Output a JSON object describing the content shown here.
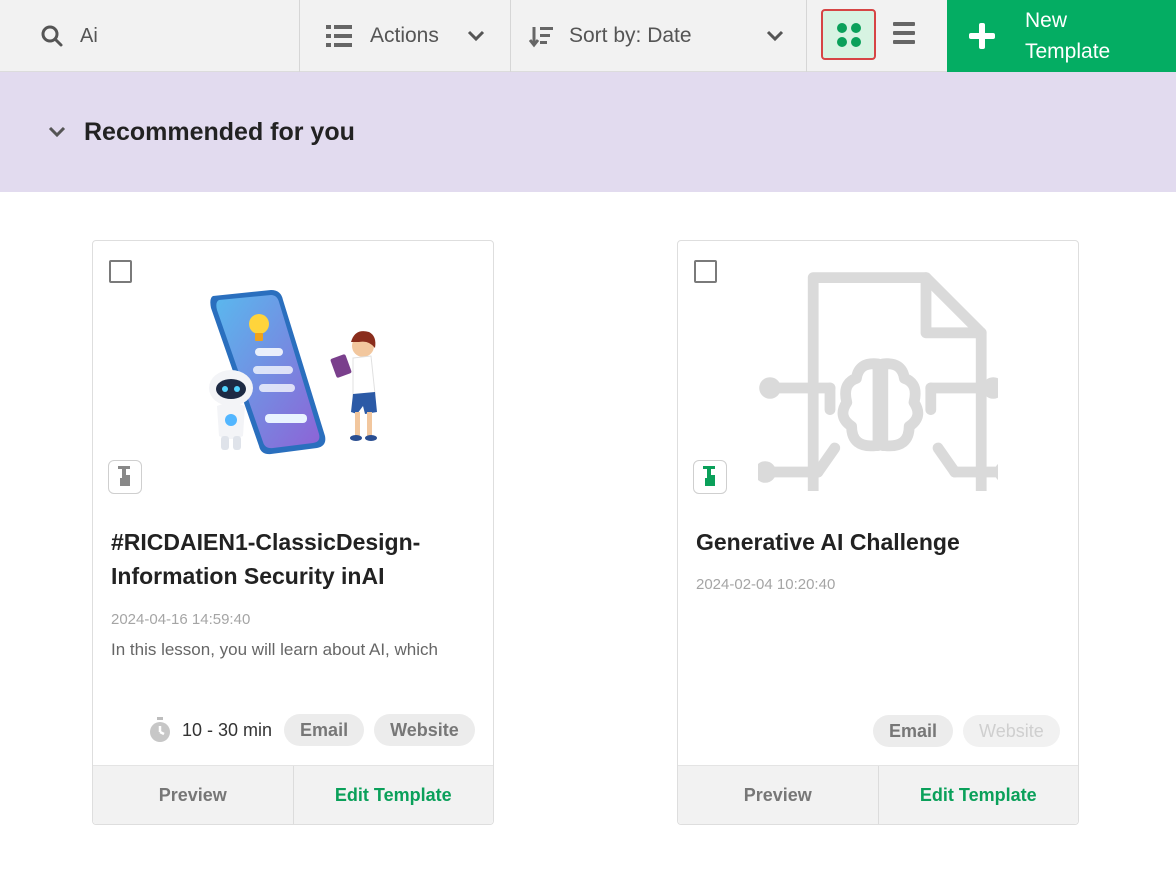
{
  "toolbar": {
    "search": {
      "value": "Ai",
      "icon": "search-icon"
    },
    "actions_label": "Actions",
    "sort_label": "Sort by: Date",
    "new_template_label": "New Template",
    "accent": "#04ad63",
    "grid_view_active": true
  },
  "section": {
    "title": "Recommended for you",
    "background": "#e2dbef"
  },
  "cards": [
    {
      "title": "#RICDAIEN1-ClassicDesign-Information Security inAI",
      "date": "2024-04-16 14:59:40",
      "description": "In this lesson, you will learn about AI, which",
      "duration": "10 - 30 min",
      "channels": [
        "Email",
        "Website"
      ],
      "website_enabled": true,
      "interactive_badge_color": "#777777",
      "preview_label": "Preview",
      "edit_label": "Edit Template"
    },
    {
      "title": "Generative AI Challenge",
      "date": "2024-02-04 10:20:40",
      "channels": [
        "Email",
        "Website"
      ],
      "website_enabled": false,
      "interactive_badge_color": "#0aa05a",
      "preview_label": "Preview",
      "edit_label": "Edit Template"
    }
  ]
}
